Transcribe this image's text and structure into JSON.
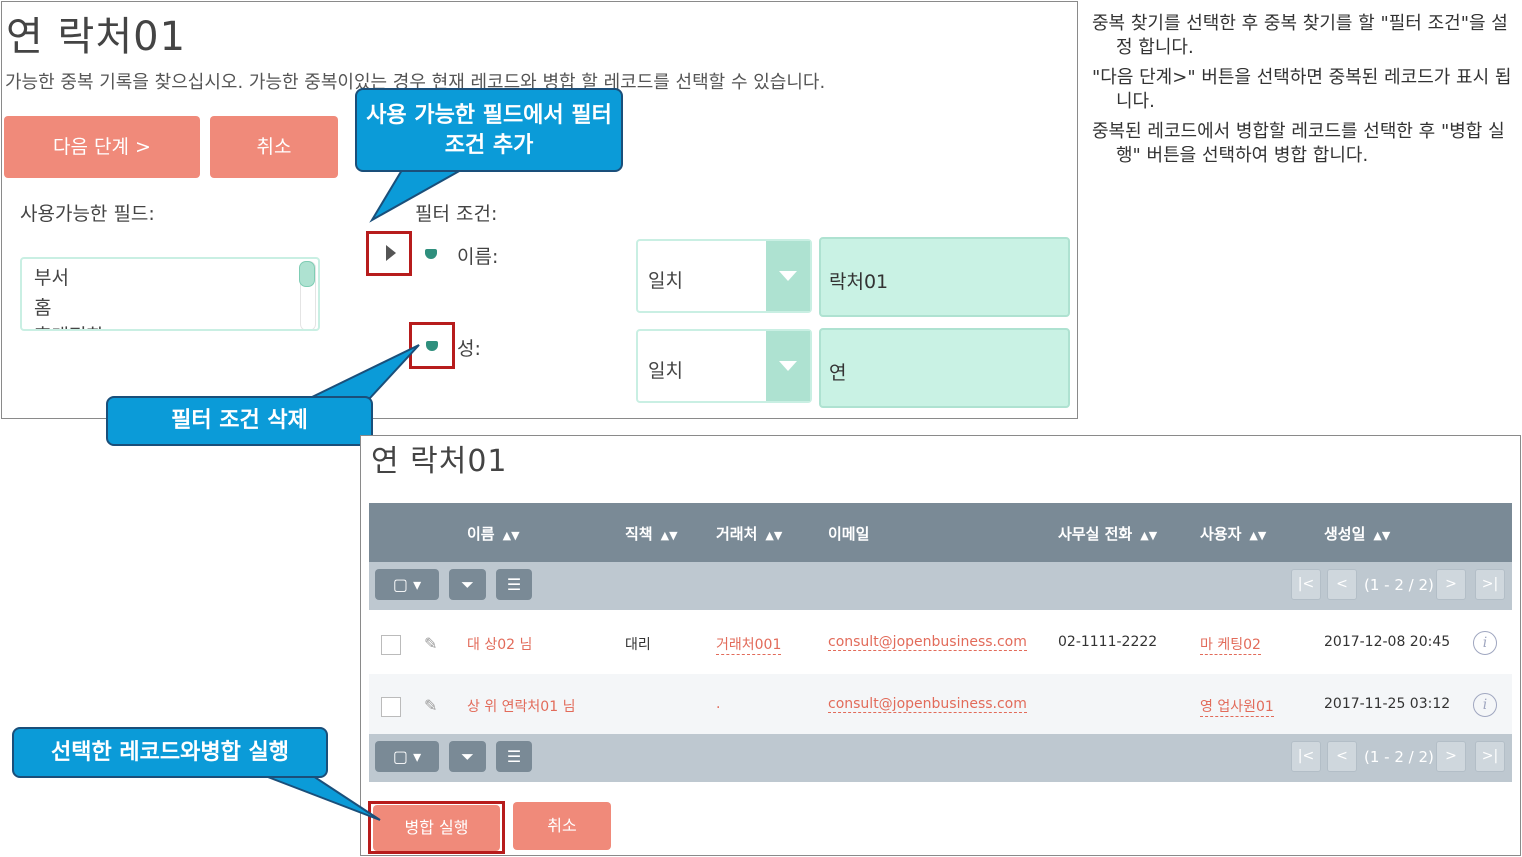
{
  "panel1": {
    "title": "연 락처01",
    "description": "가능한 중복 기록을 찾으십시오. 가능한 중복이있는 경우 현재 레코드와 병합 할 레코드를 선택할 수 있습니다.",
    "next_button": "다음 단계 >",
    "cancel_button": "취소",
    "available_fields_label": "사용가능한 필드:",
    "available_fields": [
      "부서",
      "홈",
      "휴대전화"
    ],
    "filter_label": "필터 조건:",
    "filters": [
      {
        "label": "이름:",
        "operator": "일치",
        "value": "락처01"
      },
      {
        "label": "성:",
        "operator": "일치",
        "value": "연"
      }
    ]
  },
  "callouts": {
    "add_filter": "사용 가능한 필드에서 필터 조건 추가",
    "delete_filter": "필터 조건 삭제",
    "merge": "선택한 레코드와병합 실행"
  },
  "notes": [
    "중복 찾기를 선택한 후 중복 찾기를 할 \"필터 조건\"을 설정 합니다.",
    "\"다음 단계>\" 버튼을 선택하면 중복된 레코드가 표시 됩니다.",
    "중복된 레코드에서 병합할 레코드를 선택한 후 \"병합 실행\" 버튼을 선택하여 병합 합니다."
  ],
  "panel2": {
    "title": "연 락처01",
    "columns": [
      "이름",
      "직책",
      "거래처",
      "이메일",
      "사무실 전화",
      "사용자",
      "생성일"
    ],
    "pagination": "(1 - 2 / 2)",
    "rows": [
      {
        "name": "대 상02 님",
        "title": "대리",
        "account": "거래처001",
        "email": "consult@jopenbusiness.com",
        "phone": "02-1111-2222",
        "user": "마 케팅02",
        "created": "2017-12-08 20:45"
      },
      {
        "name": "상 위 연락처01 님",
        "title": "",
        "account": ".",
        "email": "consult@jopenbusiness.com",
        "phone": "",
        "user": "영 업사원01",
        "created": "2017-11-25 03:12"
      }
    ],
    "merge_button": "병합 실행",
    "cancel_button": "취소"
  },
  "colors": {
    "salmon": "#f08a7a",
    "mint": "#c9f2e4",
    "header": "#7a8a96",
    "callout": "#0b9bd8",
    "highlight": "#b71c1c"
  }
}
